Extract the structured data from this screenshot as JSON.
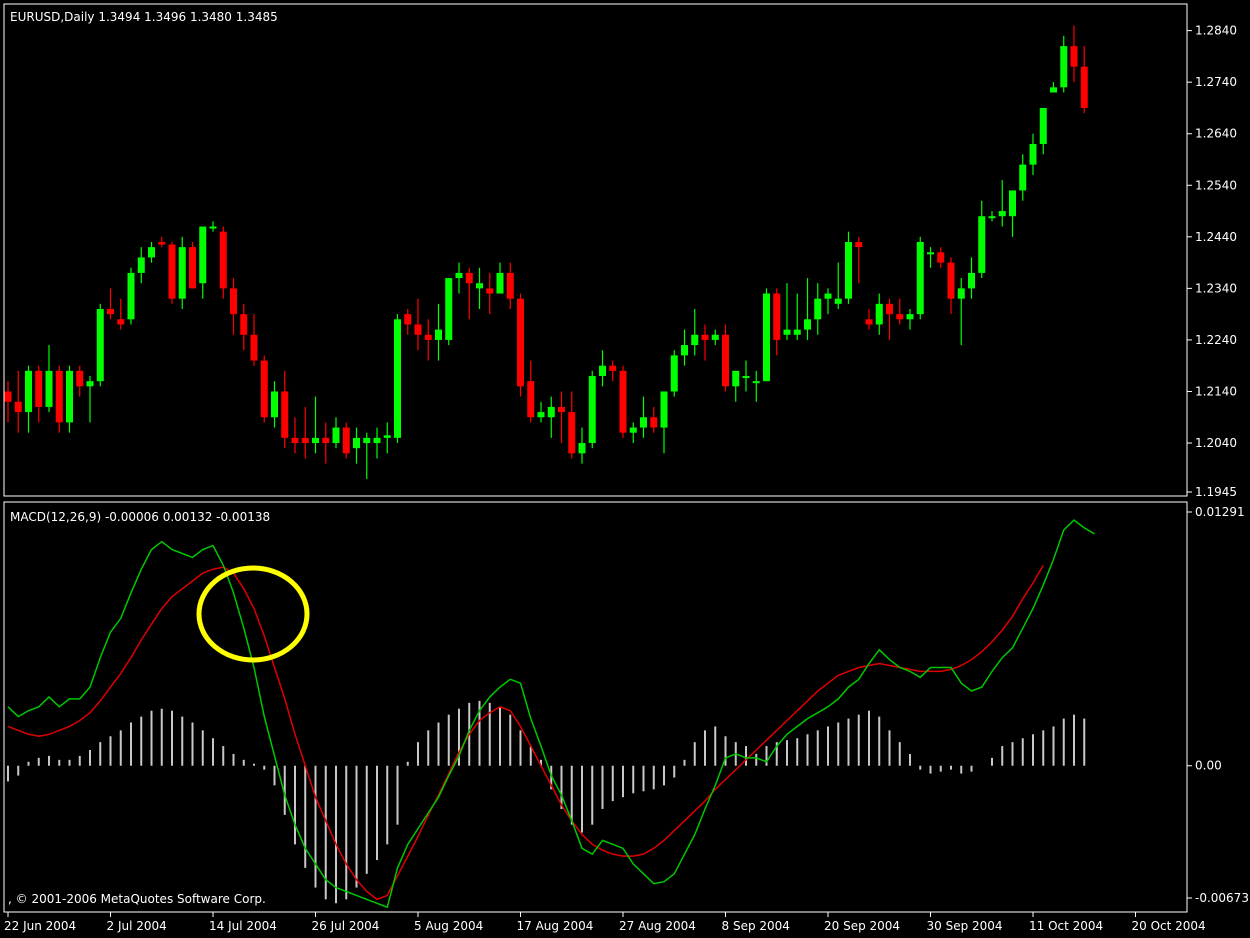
{
  "price_header": "EURUSD,Daily  1.3494 1.3496 1.3480 1.3485",
  "macd_header": "MACD(12,26,9) -0.00006 0.00132 -0.00138",
  "copyright": ", © 2001-2006 MetaQuotes Software Corp.",
  "colors": {
    "background": "#000000",
    "bull": "#00ff00",
    "bear": "#ff0000",
    "macd_line": "#00c800",
    "signal_line": "#e00000",
    "histogram": "#c8c8c8",
    "highlight": "#ffff00",
    "frame": "#ffffff"
  },
  "chart_data": [
    {
      "type": "candlestick",
      "title": "EURUSD,Daily  1.3494 1.3496 1.3480 1.3485",
      "y_ticks": [
        "1.2840",
        "1.2740",
        "1.2640",
        "1.2540",
        "1.2440",
        "1.2340",
        "1.2240",
        "1.2140",
        "1.2040",
        "1.1945"
      ],
      "ylim": [
        1.1945,
        1.288
      ],
      "x_ticks": [
        "22 Jun 2004",
        "2 Jul 2004",
        "14 Jul 2004",
        "26 Jul 2004",
        "5 Aug 2004",
        "17 Aug 2004",
        "27 Aug 2004",
        "8 Sep 2004",
        "20 Sep 2004",
        "30 Sep 2004",
        "11 Oct 2004",
        "20 Oct 2004"
      ],
      "x_tick_index": [
        0,
        10,
        20,
        30,
        40,
        50,
        60,
        70,
        80,
        90,
        100,
        110
      ],
      "candles": [
        [
          1.214,
          1.216,
          1.208,
          1.212
        ],
        [
          1.212,
          1.218,
          1.206,
          1.21
        ],
        [
          1.21,
          1.219,
          1.206,
          1.218
        ],
        [
          1.218,
          1.219,
          1.208,
          1.211
        ],
        [
          1.211,
          1.223,
          1.21,
          1.218
        ],
        [
          1.218,
          1.219,
          1.206,
          1.208
        ],
        [
          1.208,
          1.219,
          1.206,
          1.218
        ],
        [
          1.218,
          1.219,
          1.213,
          1.215
        ],
        [
          1.215,
          1.217,
          1.208,
          1.216
        ],
        [
          1.216,
          1.231,
          1.215,
          1.23
        ],
        [
          1.23,
          1.234,
          1.228,
          1.229
        ],
        [
          1.228,
          1.232,
          1.226,
          1.227
        ],
        [
          1.228,
          1.238,
          1.227,
          1.237
        ],
        [
          1.237,
          1.242,
          1.235,
          1.24
        ],
        [
          1.24,
          1.243,
          1.239,
          1.242
        ],
        [
          1.243,
          1.244,
          1.242,
          1.2425
        ],
        [
          1.2425,
          1.243,
          1.231,
          1.232
        ],
        [
          1.232,
          1.244,
          1.23,
          1.242
        ],
        [
          1.242,
          1.243,
          1.234,
          1.234
        ],
        [
          1.235,
          1.246,
          1.232,
          1.246
        ],
        [
          1.246,
          1.247,
          1.245,
          1.246
        ],
        [
          1.245,
          1.246,
          1.232,
          1.234
        ],
        [
          1.234,
          1.236,
          1.225,
          1.229
        ],
        [
          1.229,
          1.231,
          1.222,
          1.225
        ],
        [
          1.225,
          1.229,
          1.219,
          1.22
        ],
        [
          1.22,
          1.221,
          1.208,
          1.209
        ],
        [
          1.209,
          1.216,
          1.207,
          1.214
        ],
        [
          1.214,
          1.218,
          1.203,
          1.205
        ],
        [
          1.205,
          1.209,
          1.202,
          1.204
        ],
        [
          1.205,
          1.211,
          1.201,
          1.204
        ],
        [
          1.204,
          1.213,
          1.202,
          1.205
        ],
        [
          1.205,
          1.208,
          1.2,
          1.204
        ],
        [
          1.204,
          1.209,
          1.203,
          1.207
        ],
        [
          1.207,
          1.208,
          1.201,
          1.202
        ],
        [
          1.203,
          1.207,
          1.2,
          1.205
        ],
        [
          1.204,
          1.206,
          1.197,
          1.205
        ],
        [
          1.204,
          1.207,
          1.201,
          1.205
        ],
        [
          1.205,
          1.208,
          1.202,
          1.2055
        ],
        [
          1.205,
          1.229,
          1.204,
          1.228
        ],
        [
          1.229,
          1.23,
          1.225,
          1.227
        ],
        [
          1.227,
          1.232,
          1.222,
          1.225
        ],
        [
          1.225,
          1.228,
          1.22,
          1.224
        ],
        [
          1.224,
          1.231,
          1.22,
          1.226
        ],
        [
          1.224,
          1.236,
          1.223,
          1.236
        ],
        [
          1.236,
          1.239,
          1.233,
          1.237
        ],
        [
          1.237,
          1.238,
          1.228,
          1.235
        ],
        [
          1.234,
          1.238,
          1.23,
          1.235
        ],
        [
          1.234,
          1.237,
          1.229,
          1.233
        ],
        [
          1.233,
          1.239,
          1.233,
          1.237
        ],
        [
          1.237,
          1.239,
          1.23,
          1.232
        ],
        [
          1.232,
          1.233,
          1.213,
          1.215
        ],
        [
          1.216,
          1.22,
          1.208,
          1.209
        ],
        [
          1.209,
          1.212,
          1.208,
          1.21
        ],
        [
          1.209,
          1.213,
          1.205,
          1.211
        ],
        [
          1.211,
          1.214,
          1.204,
          1.21
        ],
        [
          1.21,
          1.214,
          1.201,
          1.202
        ],
        [
          1.202,
          1.207,
          1.2,
          1.204
        ],
        [
          1.204,
          1.218,
          1.203,
          1.217
        ],
        [
          1.217,
          1.222,
          1.215,
          1.219
        ],
        [
          1.219,
          1.22,
          1.216,
          1.218
        ],
        [
          1.218,
          1.219,
          1.205,
          1.206
        ],
        [
          1.206,
          1.208,
          1.204,
          1.207
        ],
        [
          1.207,
          1.213,
          1.205,
          1.209
        ],
        [
          1.209,
          1.211,
          1.206,
          1.207
        ],
        [
          1.207,
          1.214,
          1.202,
          1.214
        ],
        [
          1.214,
          1.222,
          1.213,
          1.221
        ],
        [
          1.221,
          1.226,
          1.219,
          1.223
        ],
        [
          1.223,
          1.23,
          1.221,
          1.225
        ],
        [
          1.225,
          1.227,
          1.22,
          1.224
        ],
        [
          1.224,
          1.226,
          1.223,
          1.225
        ],
        [
          1.225,
          1.227,
          1.214,
          1.215
        ],
        [
          1.215,
          1.218,
          1.212,
          1.218
        ],
        [
          1.217,
          1.22,
          1.214,
          1.217
        ],
        [
          1.216,
          1.218,
          1.212,
          1.216
        ],
        [
          1.216,
          1.234,
          1.216,
          1.233
        ],
        [
          1.233,
          1.234,
          1.221,
          1.224
        ],
        [
          1.225,
          1.235,
          1.224,
          1.226
        ],
        [
          1.225,
          1.233,
          1.224,
          1.226
        ],
        [
          1.226,
          1.236,
          1.224,
          1.228
        ],
        [
          1.228,
          1.235,
          1.225,
          1.232
        ],
        [
          1.232,
          1.234,
          1.229,
          1.233
        ],
        [
          1.231,
          1.239,
          1.23,
          1.232
        ],
        [
          1.232,
          1.245,
          1.231,
          1.243
        ],
        [
          1.243,
          1.244,
          1.235,
          1.242
        ],
        [
          1.228,
          1.23,
          1.226,
          1.227
        ],
        [
          1.227,
          1.233,
          1.225,
          1.231
        ],
        [
          1.231,
          1.232,
          1.224,
          1.229
        ],
        [
          1.229,
          1.232,
          1.227,
          1.228
        ],
        [
          1.228,
          1.23,
          1.226,
          1.229
        ],
        [
          1.229,
          1.244,
          1.228,
          1.243
        ],
        [
          1.241,
          1.242,
          1.238,
          1.241
        ],
        [
          1.241,
          1.242,
          1.238,
          1.239
        ],
        [
          1.239,
          1.24,
          1.229,
          1.232
        ],
        [
          1.232,
          1.236,
          1.223,
          1.234
        ],
        [
          1.234,
          1.24,
          1.232,
          1.237
        ],
        [
          1.237,
          1.251,
          1.236,
          1.248
        ],
        [
          1.248,
          1.249,
          1.247,
          1.248
        ],
        [
          1.248,
          1.255,
          1.246,
          1.249
        ],
        [
          1.248,
          1.252,
          1.244,
          1.253
        ],
        [
          1.253,
          1.26,
          1.251,
          1.258
        ],
        [
          1.258,
          1.264,
          1.256,
          1.262
        ],
        [
          1.262,
          1.267,
          1.26,
          1.269
        ],
        [
          1.272,
          1.274,
          1.272,
          1.273
        ],
        [
          1.273,
          1.283,
          1.272,
          1.281
        ],
        [
          1.281,
          1.285,
          1.274,
          1.277
        ],
        [
          1.277,
          1.281,
          1.268,
          1.269
        ]
      ]
    },
    {
      "type": "line",
      "title": "MACD(12,26,9) -0.00006 0.00132 -0.00138",
      "y_ticks": [
        "0.01291",
        "0.00",
        "-0.00673"
      ],
      "ylim": [
        -0.00673,
        0.01291
      ],
      "series": [
        {
          "role": "macd",
          "values": [
            0.003,
            0.0025,
            0.0028,
            0.003,
            0.0035,
            0.003,
            0.0034,
            0.0034,
            0.004,
            0.0055,
            0.0068,
            0.0075,
            0.0088,
            0.01,
            0.011,
            0.0114,
            0.011,
            0.0108,
            0.0106,
            0.011,
            0.0112,
            0.0102,
            0.0088,
            0.007,
            0.005,
            0.0025,
            0.0005,
            -0.0015,
            -0.003,
            -0.0042,
            -0.005,
            -0.0058,
            -0.0062,
            -0.0064,
            -0.0066,
            -0.0068,
            -0.007,
            -0.0072,
            -0.0052,
            -0.004,
            -0.0032,
            -0.0024,
            -0.0016,
            -0.0005,
            0.0005,
            0.0018,
            0.0028,
            0.0035,
            0.004,
            0.0044,
            0.0042,
            0.0024,
            0.001,
            -0.0005,
            -0.0015,
            -0.0028,
            -0.0042,
            -0.0045,
            -0.0038,
            -0.004,
            -0.0042,
            -0.005,
            -0.0055,
            -0.006,
            -0.0059,
            -0.0055,
            -0.0045,
            -0.0035,
            -0.0022,
            -0.001,
            0.0004,
            0.0006,
            0.0004,
            0.0004,
            0.0002,
            0.001,
            0.0016,
            0.002,
            0.0024,
            0.0027,
            0.003,
            0.0034,
            0.004,
            0.0044,
            0.0052,
            0.0059,
            0.0054,
            0.005,
            0.0048,
            0.0045,
            0.005,
            0.005,
            0.005,
            0.0042,
            0.0038,
            0.004,
            0.0048,
            0.0055,
            0.006,
            0.007,
            0.008,
            0.0092,
            0.0105,
            0.012,
            0.0125,
            0.0121,
            0.0118
          ]
        },
        {
          "role": "signal",
          "values": [
            0.002,
            0.0018,
            0.0016,
            0.0015,
            0.0016,
            0.0018,
            0.002,
            0.0023,
            0.0027,
            0.0033,
            0.004,
            0.0047,
            0.0055,
            0.0064,
            0.0072,
            0.008,
            0.0086,
            0.009,
            0.0094,
            0.0098,
            0.01,
            0.0101,
            0.0098,
            0.009,
            0.008,
            0.0066,
            0.005,
            0.0034,
            0.0016,
            0.0,
            -0.0016,
            -0.0028,
            -0.004,
            -0.005,
            -0.0058,
            -0.0064,
            -0.0068,
            -0.0066,
            -0.0056,
            -0.0046,
            -0.0036,
            -0.0025,
            -0.0015,
            -0.0004,
            0.0007,
            0.0016,
            0.0023,
            0.0027,
            0.003,
            0.0028,
            0.002,
            0.001,
            0.0,
            -0.001,
            -0.002,
            -0.0028,
            -0.0035,
            -0.004,
            -0.0043,
            -0.0045,
            -0.0046,
            -0.0046,
            -0.0045,
            -0.0042,
            -0.0038,
            -0.0033,
            -0.0028,
            -0.0023,
            -0.0018,
            -0.0012,
            -0.0007,
            -0.0002,
            0.0003,
            0.0008,
            0.0013,
            0.0018,
            0.0023,
            0.0028,
            0.0033,
            0.0038,
            0.0042,
            0.0046,
            0.0048,
            0.005,
            0.0051,
            0.0052,
            0.0051,
            0.005,
            0.0049,
            0.0048,
            0.0048,
            0.0048,
            0.0049,
            0.0051,
            0.0054,
            0.0058,
            0.0063,
            0.0069,
            0.0076,
            0.0085,
            0.0093,
            0.0102
          ]
        },
        {
          "role": "histogram",
          "values": [
            -0.0008,
            -0.0005,
            0.0002,
            0.0004,
            0.0005,
            0.0003,
            0.0003,
            0.0005,
            0.0008,
            0.0012,
            0.0015,
            0.0018,
            0.0022,
            0.0025,
            0.0028,
            0.0029,
            0.0028,
            0.0025,
            0.0022,
            0.0018,
            0.0014,
            0.001,
            0.0006,
            0.0003,
            0.0001,
            -0.0002,
            -0.001,
            -0.0025,
            -0.004,
            -0.0052,
            -0.0062,
            -0.0068,
            -0.007,
            -0.0068,
            -0.0062,
            -0.0055,
            -0.0048,
            -0.004,
            -0.003,
            0.0002,
            0.0012,
            0.0018,
            0.0022,
            0.0026,
            0.0029,
            0.0032,
            0.0033,
            0.0032,
            0.003,
            0.0026,
            0.0018,
            0.001,
            0.0003,
            -0.0012,
            -0.0022,
            -0.003,
            -0.0034,
            -0.003,
            -0.0022,
            -0.0018,
            -0.0016,
            -0.0014,
            -0.0013,
            -0.0012,
            -0.001,
            -0.0006,
            0.0003,
            0.0012,
            0.0018,
            0.002,
            0.0015,
            0.0012,
            0.001,
            0.0006,
            0.001,
            0.0012,
            0.0013,
            0.0014,
            0.0016,
            0.0018,
            0.002,
            0.0022,
            0.0024,
            0.0026,
            0.0028,
            0.0025,
            0.0018,
            0.0012,
            0.0006,
            -0.0002,
            -0.0004,
            -0.0003,
            -0.0002,
            -0.0004,
            -0.0003,
            0.0,
            0.0004,
            0.001,
            0.0012,
            0.0014,
            0.0016,
            0.0018,
            0.002,
            0.0024,
            0.0026,
            0.0024
          ]
        }
      ]
    }
  ]
}
